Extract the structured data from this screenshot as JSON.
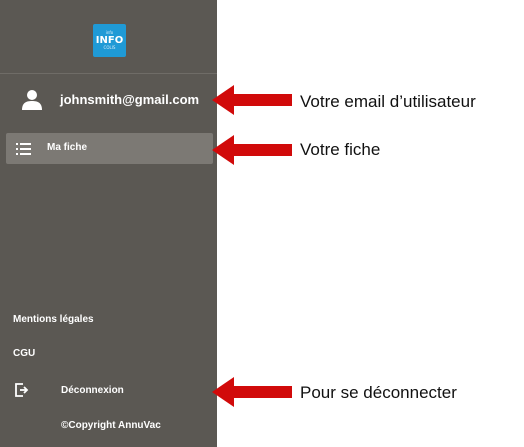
{
  "sidebar": {
    "logo": {
      "top_text": "info",
      "main_text": "INFO",
      "bottom_text": "COLIS",
      "bg_color": "#1f9ad6"
    },
    "user": {
      "email": "johnsmith@gmail.com",
      "icon": "user-icon"
    },
    "menu": {
      "fiche_label": "Ma fiche",
      "fiche_icon": "list-icon"
    },
    "footer": {
      "mentions": "Mentions légales",
      "cgu": "CGU",
      "logout_label": "Déconnexion",
      "logout_icon": "logout-icon",
      "copyright": "©Copyright AnnuVac"
    },
    "bg_color": "#5b5853",
    "active_item_color": "#7c7974"
  },
  "annotations": {
    "email": "Votre email d’utilisateur",
    "fiche": "Votre fiche",
    "logout": "Pour se déconnecter",
    "arrow_color": "#d10a0a"
  }
}
